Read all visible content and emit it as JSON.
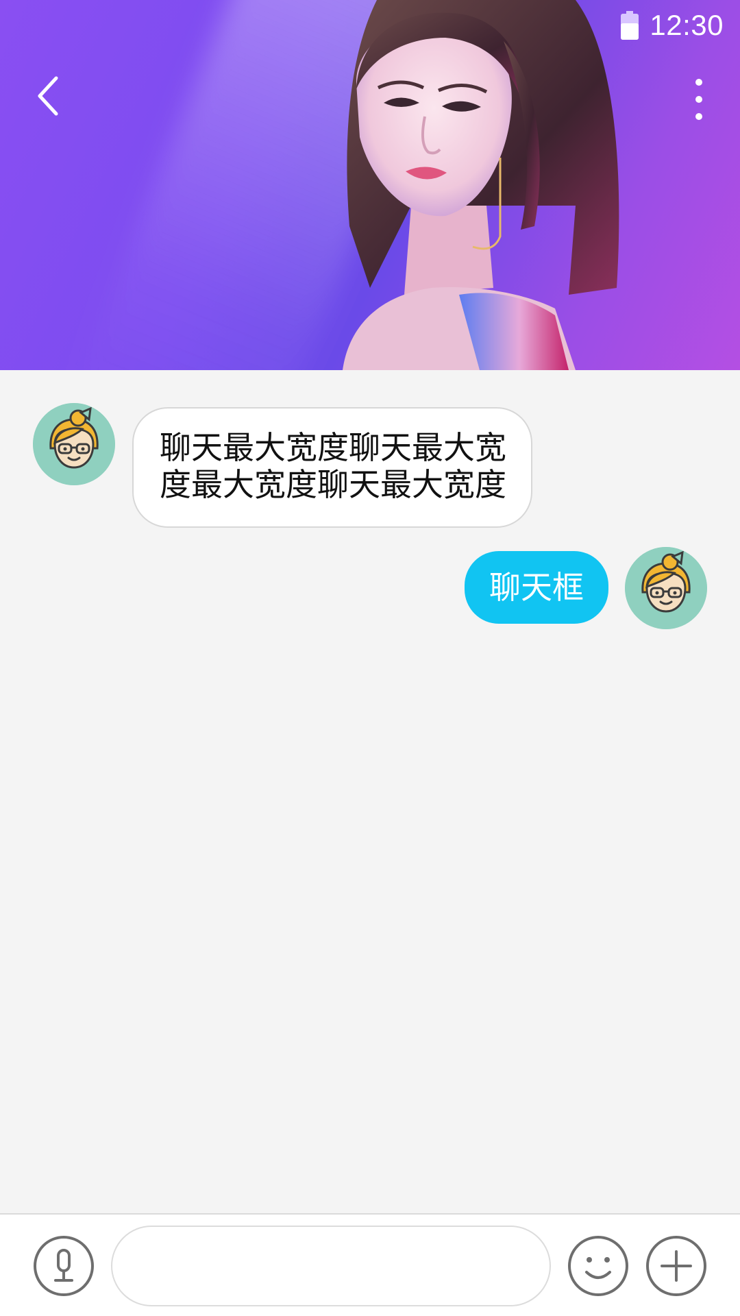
{
  "status_bar": {
    "time": "12:30",
    "icons": [
      "battery-icon"
    ]
  },
  "header": {
    "back_icon": "chevron-left-icon",
    "more_icon": "more-vertical-icon",
    "cover": "profile-cover-photo"
  },
  "colors": {
    "header_gradient": [
      "#8a4ff2",
      "#6a4ae8",
      "#b44fe3"
    ],
    "outgoing_bubble": "#11c4f2",
    "incoming_bubble": "#ffffff",
    "avatar_background": "#8fd0bf",
    "page_background": "#f4f4f4"
  },
  "messages": [
    {
      "direction": "incoming",
      "text": "聊天最大宽度聊天最大宽度最大宽度聊天最大宽度",
      "avatar": "avatar-cartoon-girl-icon"
    },
    {
      "direction": "outgoing",
      "text": "聊天框",
      "avatar": "avatar-cartoon-girl-icon"
    }
  ],
  "input_bar": {
    "voice_icon": "microphone-icon",
    "input_value": "",
    "input_placeholder": "",
    "emoji_icon": "smiley-icon",
    "plus_icon": "plus-circle-icon"
  }
}
